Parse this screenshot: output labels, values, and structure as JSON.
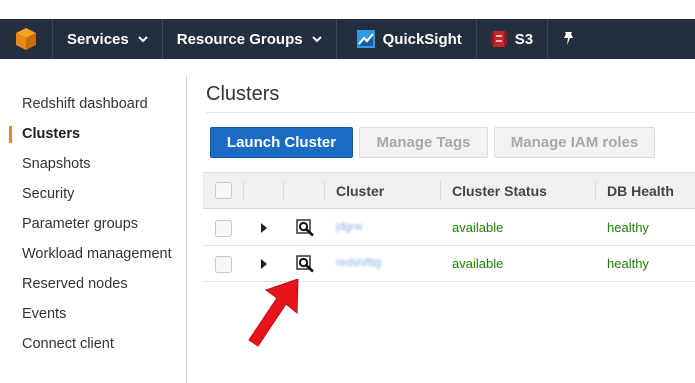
{
  "nav": {
    "logo_icon": "aws-cube-icon",
    "services_label": "Services",
    "resource_groups_label": "Resource Groups",
    "quicksight_label": "QuickSight",
    "s3_label": "S3",
    "pin_icon": "pin-icon"
  },
  "sidebar": {
    "items": [
      {
        "label": "Redshift dashboard"
      },
      {
        "label": "Clusters",
        "active": true
      },
      {
        "label": "Snapshots"
      },
      {
        "label": "Security"
      },
      {
        "label": "Parameter groups"
      },
      {
        "label": "Workload management"
      },
      {
        "label": "Reserved nodes"
      },
      {
        "label": "Events"
      },
      {
        "label": "Connect client"
      }
    ]
  },
  "main": {
    "title": "Clusters",
    "buttons": {
      "launch": "Launch Cluster",
      "manage_tags": "Manage Tags",
      "manage_iam": "Manage IAM roles"
    },
    "table": {
      "columns": [
        "Cluster",
        "Cluster Status",
        "DB Health"
      ],
      "rows": [
        {
          "cluster": "jdgrw",
          "status": "available",
          "health": "healthy"
        },
        {
          "cluster": "redshifttg",
          "status": "available",
          "health": "healthy"
        }
      ]
    }
  },
  "colors": {
    "nav_bg": "#232f3e",
    "primary_button": "#1b6dc4",
    "status_green": "#1d8102",
    "active_accent": "#e68a1a",
    "annotation_arrow": "#e8141b"
  }
}
